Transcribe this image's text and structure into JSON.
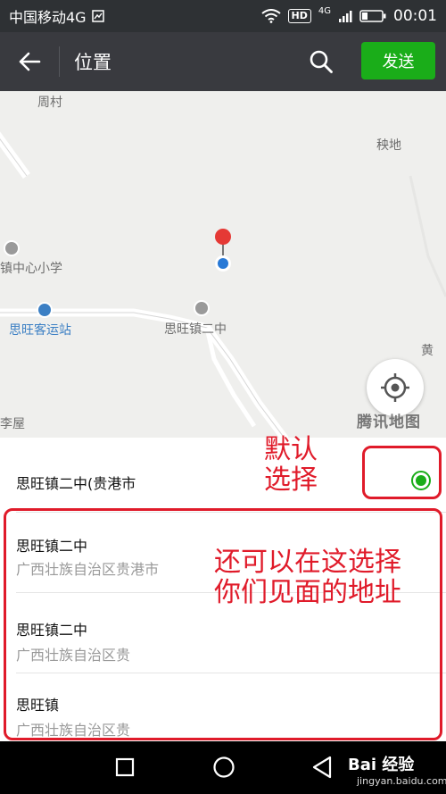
{
  "status": {
    "carrier": "中国移动4G",
    "hd": "HD",
    "net": "4G",
    "time": "00:01"
  },
  "header": {
    "title": "位置",
    "send_label": "发送"
  },
  "map": {
    "labels": {
      "zhoucun": "周村",
      "yangdi": "秧地",
      "school": "镇中心小学",
      "station": "思旺客运站",
      "middle_school": "思旺镇二中",
      "lizhu": "李屋",
      "huang": "黄"
    },
    "logo": "腾讯地图"
  },
  "list": {
    "items": [
      {
        "title": "思旺镇二中(贵港市",
        "subtitle": ""
      },
      {
        "title": "思旺镇二中",
        "subtitle": "广西壮族自治区贵港市"
      },
      {
        "title": "思旺镇二中",
        "subtitle": "广西壮族自治区贵"
      },
      {
        "title": "思旺镇",
        "subtitle": "广西壮族自治区贵"
      }
    ]
  },
  "annotations": {
    "default_select": "默认选择",
    "choose_place": "还可以在这选择你们见面的地址"
  },
  "watermark": {
    "brand": "Bai 经验",
    "url": "jingyan.baidu.com"
  },
  "colors": {
    "accent": "#1aad19",
    "header_bg": "#393a3f",
    "annotation": "#e01b2a"
  }
}
